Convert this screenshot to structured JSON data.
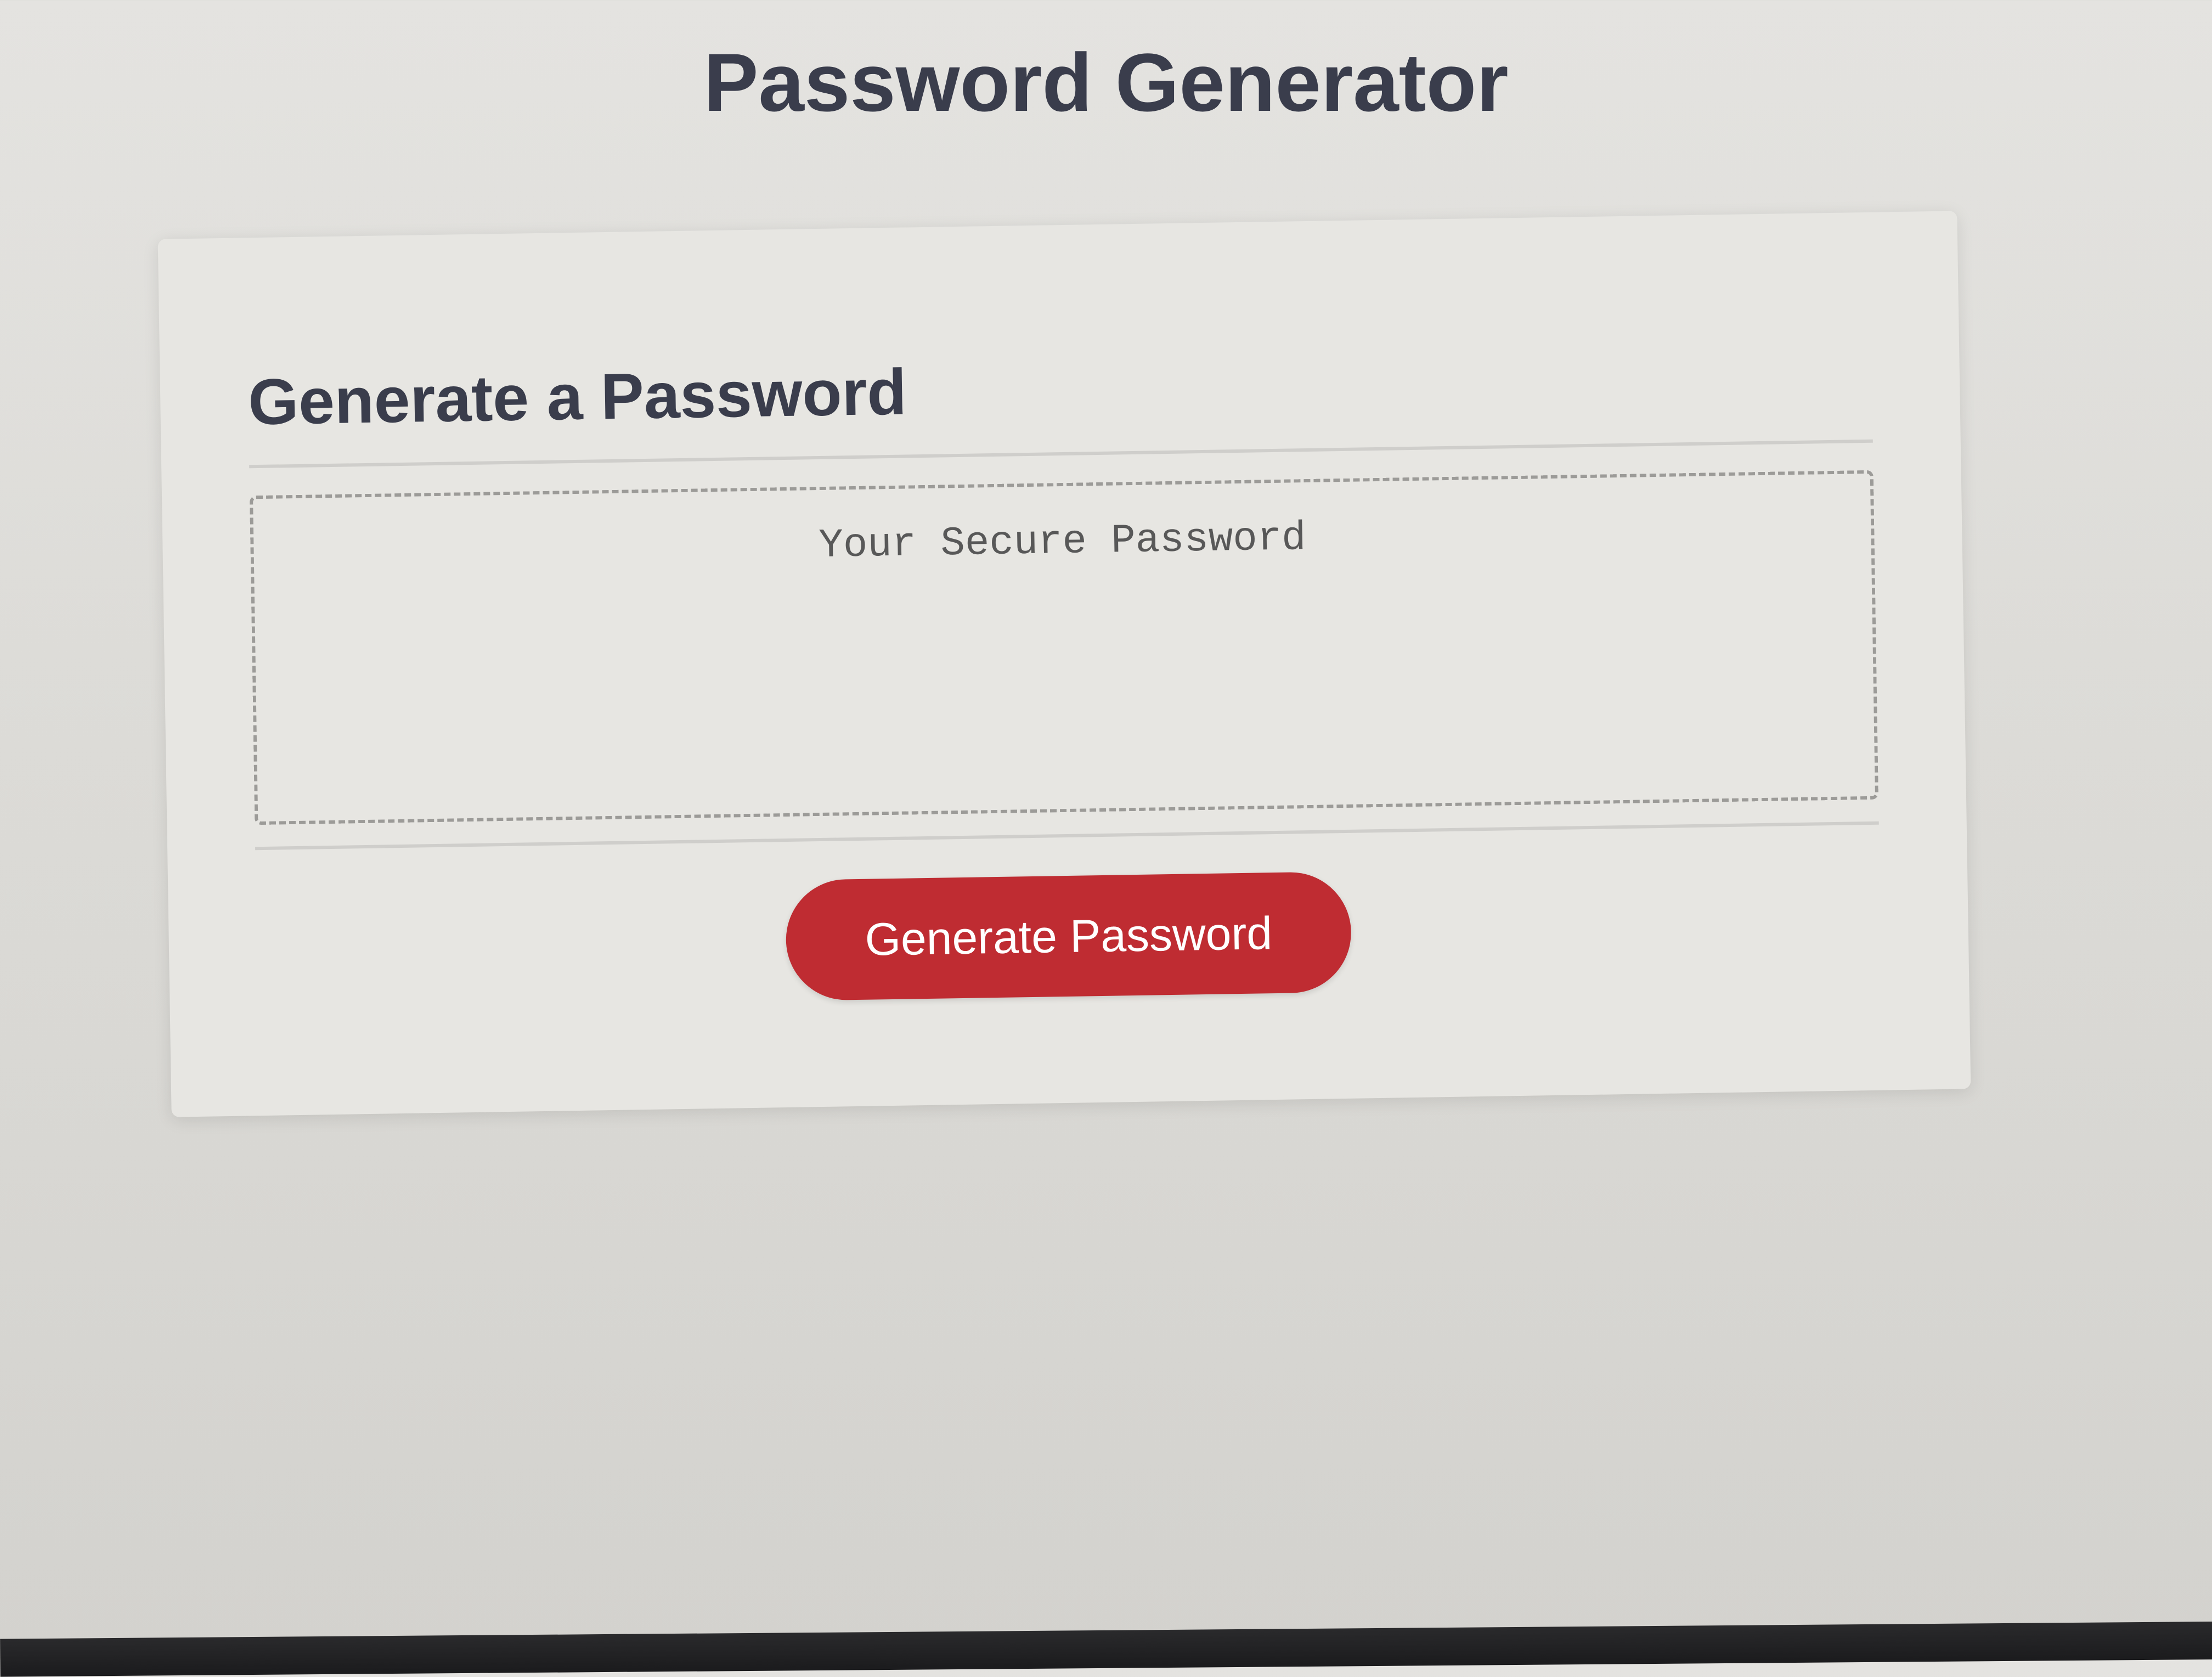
{
  "header": {
    "title": "Password Generator"
  },
  "card": {
    "heading": "Generate a Password",
    "password_field": {
      "value": "",
      "placeholder": "Your Secure Password"
    },
    "generate_button_label": "Generate Password"
  },
  "colors": {
    "background": "#dcdbd7",
    "card": "#e7e6e2",
    "title_text": "#3a3d4c",
    "button": "#bf2c32",
    "button_text": "#ffffff",
    "dashed_border": "#9c9b98"
  }
}
